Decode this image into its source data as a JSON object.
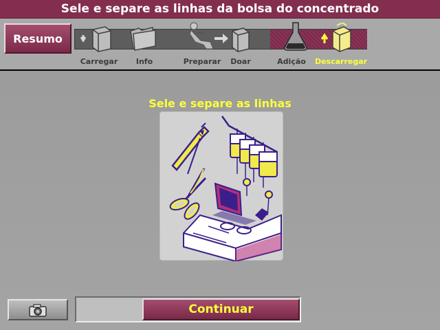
{
  "title": "Sele e separe as linhas da bolsa do concentrado",
  "nav": {
    "summary_label": "Resumo",
    "steps": [
      {
        "label": "Carregar",
        "icon": "load-icon",
        "state": "inactive"
      },
      {
        "label": "Info",
        "icon": "folder-icon",
        "state": "inactive"
      },
      {
        "label": "Preparar",
        "icon": "donor-icon",
        "state": "inactive"
      },
      {
        "label": "Doar",
        "icon": "arrow-machine-icon",
        "state": "inactive"
      },
      {
        "label": "Adição",
        "icon": "flask-icon",
        "state": "inactive"
      },
      {
        "label": "Descarregar",
        "icon": "unload-icon",
        "state": "active"
      }
    ]
  },
  "main": {
    "instruction": "Sele e separe as linhas",
    "illustration_icon": "seal-and-separate-illustration"
  },
  "footer": {
    "camera_icon": "camera-icon",
    "continue_label": "Continuar"
  },
  "colors": {
    "brand": "#832e4f",
    "highlight_text": "#ffff3a",
    "illustration_line": "#3a1f8a",
    "illustration_fill": "#f0ea4a",
    "illustration_accent": "#b0307a"
  }
}
